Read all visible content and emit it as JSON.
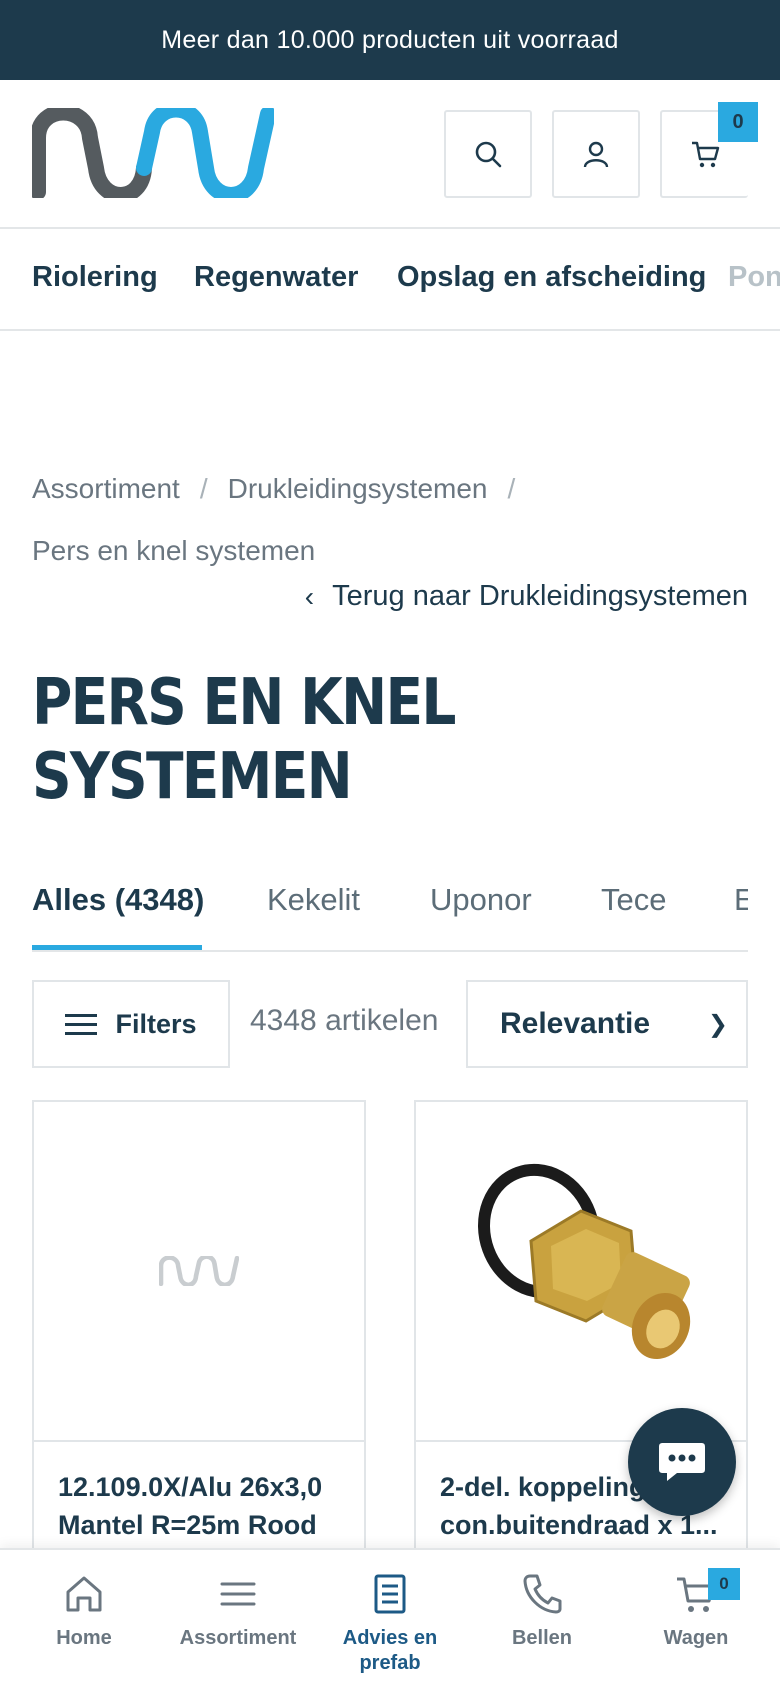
{
  "topbar": {
    "message": "Meer dan 10.000 producten uit voorraad"
  },
  "header": {
    "cart_count": "0"
  },
  "category_nav": [
    "Riolering",
    "Regenwater",
    "Opslag en afscheiding",
    "Pon"
  ],
  "breadcrumb": {
    "items": [
      "Assortiment",
      "Drukleidingsystemen",
      "Pers en knel systemen"
    ],
    "separator": "/"
  },
  "back_link": "Terug naar Drukleidingsystemen",
  "page_title": "PERS EN KNEL SYSTEMEN",
  "tabs": [
    "Alles (4348)",
    "Kekelit",
    "Uponor",
    "Tece",
    "E"
  ],
  "toolbar": {
    "filters_label": "Filters",
    "count_label": "4348 artikelen",
    "sort_label": "Relevantie"
  },
  "products": [
    {
      "name": "12.109.0X/Alu 26x3,0 Mantel R=25m Rood",
      "image": "placeholder-logo"
    },
    {
      "name": "2-del. koppeling con.buitendraad x 1...",
      "image": "brass-coupling"
    }
  ],
  "bottom_nav": {
    "items": [
      "Home",
      "Assortiment",
      "Advies en prefab",
      "Bellen",
      "Wagen"
    ],
    "cart_count": "0"
  },
  "colors": {
    "primary": "#1d3a4c",
    "accent": "#2aa9e0",
    "logo_gray": "#555b5f"
  }
}
